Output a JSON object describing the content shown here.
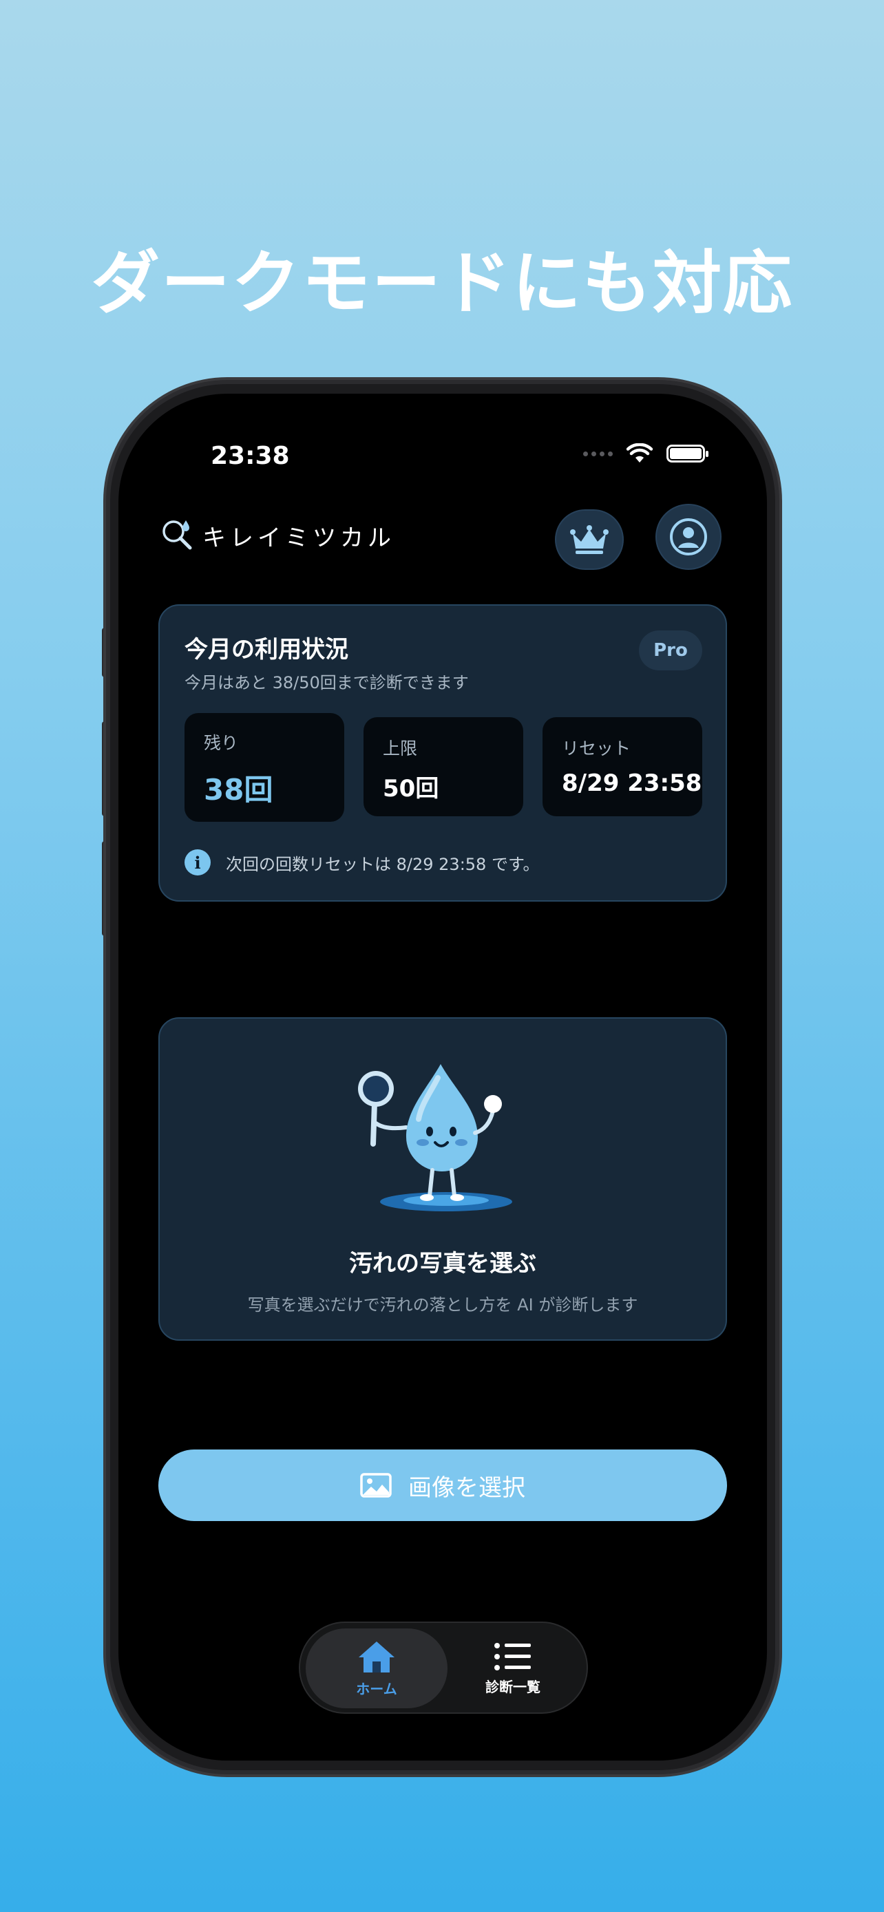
{
  "headline": "ダークモードにも対応",
  "status_bar": {
    "time": "23:38"
  },
  "header": {
    "app_name": "キレイミツカル",
    "crown_icon": "crown-icon",
    "profile_icon": "profile-icon"
  },
  "usage": {
    "title": "今月の利用状況",
    "subtitle": "今月はあと 38/50回まで診断できます",
    "badge": "Pro",
    "stats": [
      {
        "label": "残り",
        "value": "38回",
        "color": "#7ec7ef"
      },
      {
        "label": "上限",
        "value": "50回",
        "color": "#ffffff"
      },
      {
        "label": "リセット",
        "value": "8/29 23:58",
        "color": "#ffffff"
      }
    ],
    "info": "次回の回数リセットは 8/29 23:58 です。"
  },
  "upload": {
    "title": "汚れの写真を選ぶ",
    "subtitle": "写真を選ぶだけで汚れの落とし方を AI が診断します"
  },
  "select_button": {
    "label": "画像を選択",
    "icon": "image-icon"
  },
  "tabbar": {
    "tabs": [
      {
        "label": "ホーム",
        "icon": "home-icon",
        "active": true,
        "color": "#4a9ee8"
      },
      {
        "label": "診断一覧",
        "icon": "list-icon",
        "active": false,
        "color": "#ffffff"
      }
    ]
  },
  "colors": {
    "accent": "#7ec7ef",
    "card_bg": "#172838",
    "card_border": "#274660"
  }
}
